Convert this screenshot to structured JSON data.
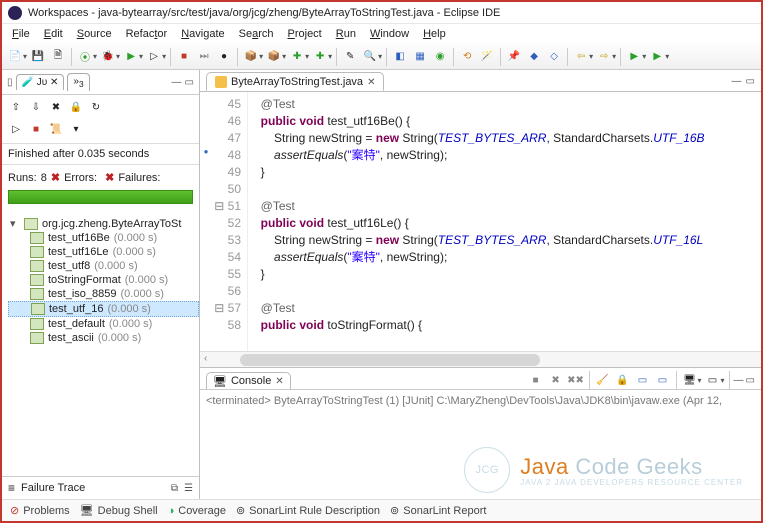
{
  "title": "Workspaces - java-bytearray/src/test/java/org/jcg/zheng/ByteArrayToStringTest.java - Eclipse IDE",
  "menu": {
    "file": "File",
    "edit": "Edit",
    "source": "Source",
    "refactor": "Refactor",
    "navigate": "Navigate",
    "search": "Search",
    "project": "Project",
    "run": "Run",
    "window": "Window",
    "help": "Help"
  },
  "junit": {
    "tab_label": "3",
    "finished": "Finished after 0.035 seconds",
    "runs_label": "Runs:",
    "runs_value": "8",
    "errors_label": "Errors:",
    "errors_value": "",
    "failures_label": "Failures:",
    "failures_value": ""
  },
  "tree": {
    "suite": "org.jcg.zheng.ByteArrayToSt",
    "items": [
      {
        "name": "test_utf16Be",
        "time": "(0.000 s)"
      },
      {
        "name": "test_utf16Le",
        "time": "(0.000 s)"
      },
      {
        "name": "test_utf8",
        "time": "(0.000 s)"
      },
      {
        "name": "toStringFormat",
        "time": "(0.000 s)"
      },
      {
        "name": "test_iso_8859",
        "time": "(0.000 s)"
      },
      {
        "name": "test_utf_16",
        "time": "(0.000 s)",
        "selected": true
      },
      {
        "name": "test_default",
        "time": "(0.000 s)"
      },
      {
        "name": "test_ascii",
        "time": "(0.000 s)"
      }
    ]
  },
  "failure_trace_label": "Failure Trace",
  "editor": {
    "tab": "ByteArrayToStringTest.java",
    "lines": [
      {
        "n": 45,
        "html": "  <span class='ann'>@Test</span>",
        "pre": ""
      },
      {
        "n": 46,
        "html": "  <span class='kw'>public</span> <span class='kw'>void</span> test_utf16Be() {"
      },
      {
        "n": 47,
        "html": "      String newString = <span class='kw'>new</span> String(<span class='const'>TEST_BYTES_ARR</span>, StandardCharsets.<span class='const'>UTF_16B</span>"
      },
      {
        "n": 48,
        "html": "      <span class='fn'>assertEquals</span>(<span class='str'>\"䅁特\"</span>, newString);",
        "bp": true
      },
      {
        "n": 49,
        "html": "  }"
      },
      {
        "n": 50,
        "html": ""
      },
      {
        "n": 51,
        "html": "  <span class='ann'>@Test</span>",
        "fold": true
      },
      {
        "n": 52,
        "html": "  <span class='kw'>public</span> <span class='kw'>void</span> test_utf16Le() {"
      },
      {
        "n": 53,
        "html": "      String newString = <span class='kw'>new</span> String(<span class='const'>TEST_BYTES_ARR</span>, StandardCharsets.<span class='const'>UTF_16L</span>"
      },
      {
        "n": 54,
        "html": "      <span class='fn'>assertEquals</span>(<span class='str'>\"䅁特\"</span>, newString);"
      },
      {
        "n": 55,
        "html": "  }"
      },
      {
        "n": 56,
        "html": ""
      },
      {
        "n": 57,
        "html": "  <span class='ann'>@Test</span>",
        "fold": true
      },
      {
        "n": 58,
        "html": "  <span class='kw'>public</span> <span class='kw'>void</span> toStringFormat() {"
      }
    ]
  },
  "console": {
    "tab": "Console",
    "status": "<terminated> ByteArrayToStringTest (1) [JUnit] C:\\MaryZheng\\DevTools\\Java\\JDK8\\bin\\javaw.exe (Apr 12,"
  },
  "bottom": {
    "problems": "Problems",
    "debug": "Debug Shell",
    "coverage": "Coverage",
    "sonar_rule": "SonarLint Rule Description",
    "sonar_report": "SonarLint Report"
  },
  "watermark": {
    "brand1": "Java",
    "brand2": "Code",
    "brand3": "Geeks",
    "tagline": "JAVA 2 JAVA DEVELOPERS RESOURCE CENTER",
    "badge": "JCG"
  }
}
